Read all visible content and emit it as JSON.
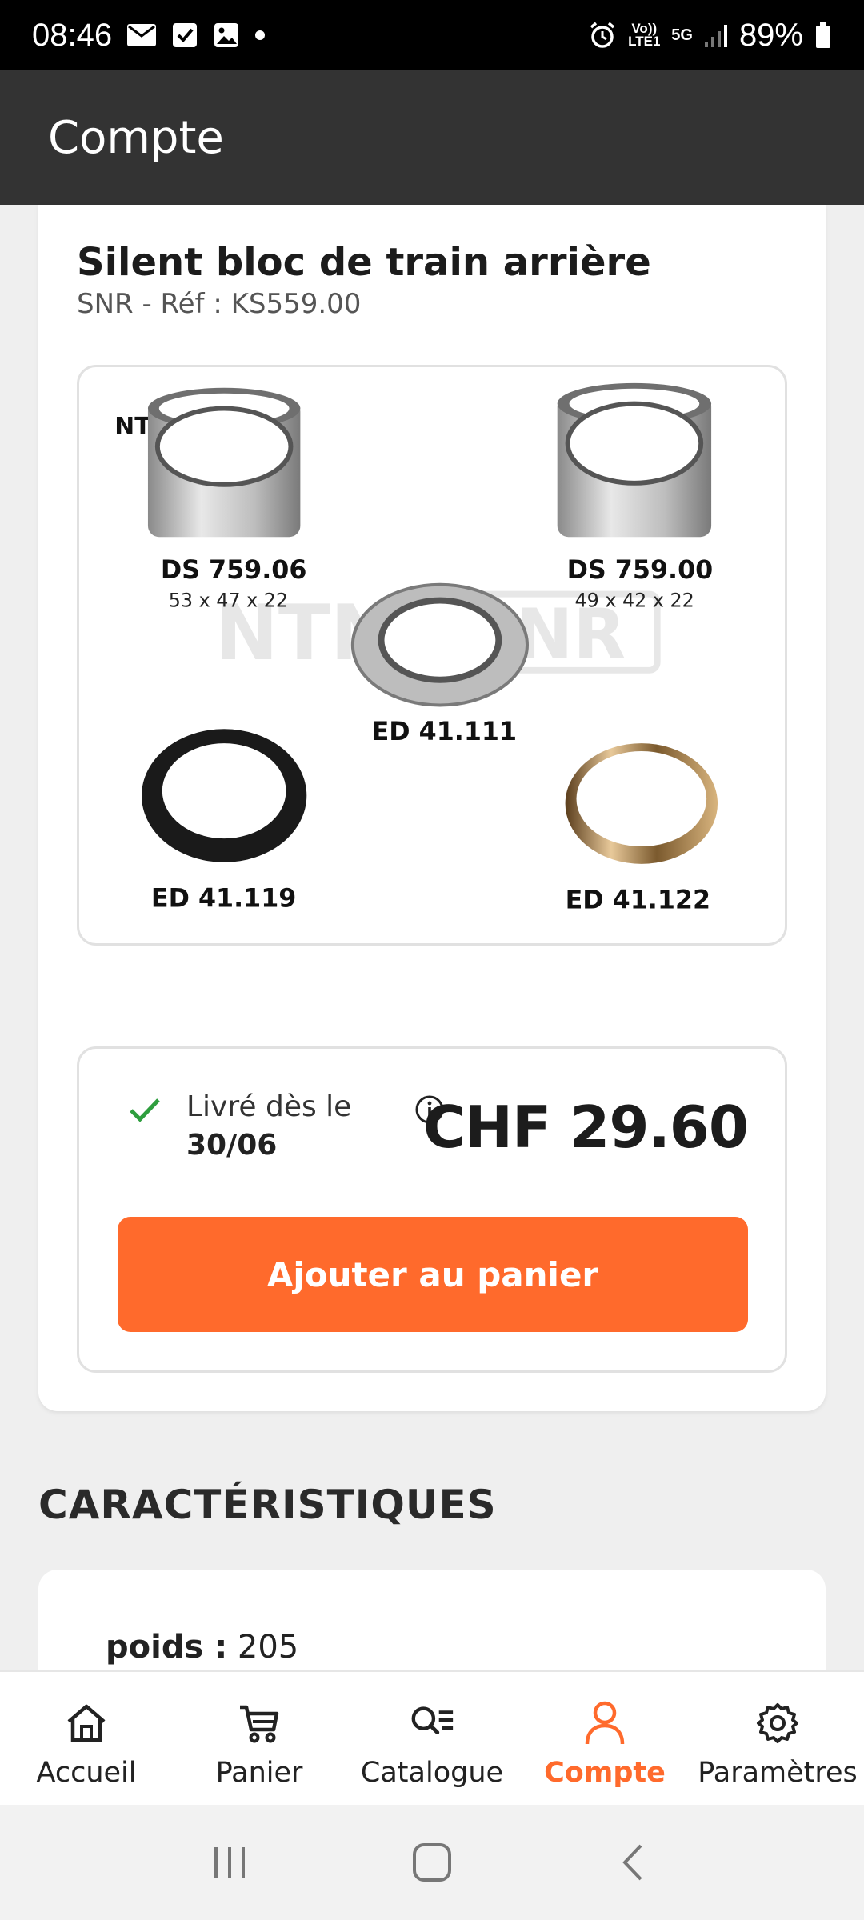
{
  "status_bar": {
    "time": "08:46",
    "volte": "Vo)) LTE1",
    "network": "5G",
    "battery": "89%"
  },
  "app_bar": {
    "title": "Compte"
  },
  "product": {
    "title": "Silent bloc de train arrière",
    "ref": "SNR - Réf : KS559.00",
    "image": {
      "brand_logo": "NTN SNR",
      "parts": [
        {
          "code": "DS 759.06",
          "dims": "53 x 47 x 22"
        },
        {
          "code": "DS 759.00",
          "dims": "49 x 42 x 22"
        },
        {
          "code": "ED 41.111",
          "dims": ""
        },
        {
          "code": "ED 41.119",
          "dims": ""
        },
        {
          "code": "ED 41.122",
          "dims": ""
        }
      ]
    }
  },
  "purchase": {
    "delivery_label": "Livré dès le",
    "delivery_date": "30/06",
    "price": "CHF 29.60",
    "add_to_cart": "Ajouter au panier"
  },
  "characteristics": {
    "heading": "CARACTÉRISTIQUES",
    "rows": [
      {
        "key": "poids :",
        "value": "205"
      }
    ]
  },
  "bottom_nav": {
    "items": [
      {
        "label": "Accueil",
        "icon": "home-icon"
      },
      {
        "label": "Panier",
        "icon": "cart-icon"
      },
      {
        "label": "Catalogue",
        "icon": "catalog-search-icon"
      },
      {
        "label": "Compte",
        "icon": "account-icon",
        "active": true
      },
      {
        "label": "Paramètres",
        "icon": "settings-icon"
      }
    ]
  },
  "colors": {
    "accent": "#ff6a2c",
    "app_bar": "#333333",
    "check": "#2e9e3e"
  }
}
